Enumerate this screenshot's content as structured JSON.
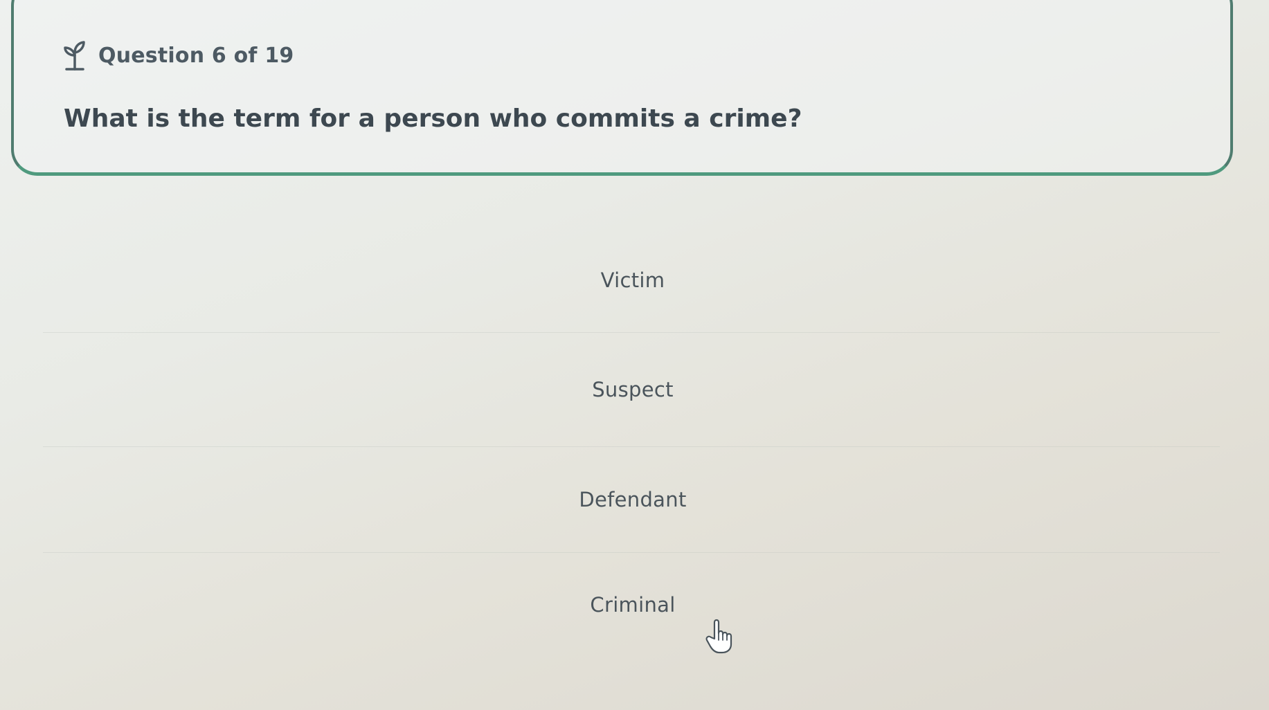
{
  "question": {
    "icon": "plant-sprout-icon",
    "counter": "Question 6 of 19",
    "text": "What is the term for a person who commits a crime?"
  },
  "options": [
    {
      "label": "Victim"
    },
    {
      "label": "Suspect"
    },
    {
      "label": "Defendant"
    },
    {
      "label": "Criminal"
    }
  ],
  "cursor": {
    "icon": "pointer-hand-icon"
  },
  "colors": {
    "card_border": "#4f7c6f",
    "card_border_bottom": "#4f9a7e",
    "text_primary": "#3d4850",
    "option_text": "#4a545b"
  }
}
